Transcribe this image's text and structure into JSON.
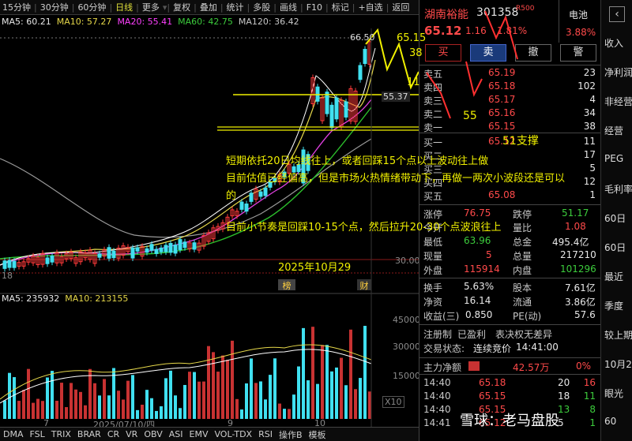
{
  "toolbar": {
    "items": [
      "15分钟",
      "30分钟",
      "60分钟",
      "日线",
      "更多",
      "复权",
      "叠加",
      "统计",
      "多股",
      "画线",
      "F10",
      "标记",
      "+自选",
      "返回"
    ],
    "selected": "日线"
  },
  "ma_legend": {
    "ma5": "MA5: 60.21",
    "ma10": "MA10: 57.27",
    "ma20": "MA20: 55.41",
    "ma60": "MA60: 42.75",
    "ma120": "MA120: 36.42"
  },
  "price_labels": {
    "high": "66.50",
    "y30": "30.00",
    "line": "55.37"
  },
  "vol_legend": {
    "ma5": "MA5: 235932",
    "ma10": "MA10: 213155"
  },
  "vol_axis": [
    "45000",
    "30000",
    "15000",
    "X10"
  ],
  "date_axis": {
    "left": "7",
    "mid": "2025/07/10/四",
    "b": "9",
    "c": "10"
  },
  "markers": {
    "bang": "榜",
    "cai": "财"
  },
  "bottom_tabs": [
    "DMA",
    "FSL",
    "TRIX",
    "BRAR",
    "CR",
    "VR",
    "OBV",
    "ASI",
    "EMV",
    "VOL-TDX",
    "RSI",
    "操作B",
    "模板"
  ],
  "annotations": {
    "a1": "短期依托20日均线往上，或者回踩15个点以上波动往上做",
    "a2": "目前估值已经偏高，但是市场火热情绪带动下，再做一两次小波段还是可以",
    "a3": "的",
    "a4": "目前小节奏是回踩10-15个点，然后拉升20-30个点波浪往上",
    "date": "2025年10月29",
    "n55": "55",
    "n51": "51支撑",
    "l38": "38",
    "l11": "11",
    "l6515": "65.15"
  },
  "stock": {
    "name": "湖南裕能",
    "code": "301358",
    "tag": "R500",
    "price": "65.12",
    "change": "1.16",
    "pct": "1.81%",
    "category": "电池",
    "cat_pct": "3.88%"
  },
  "buttons": {
    "buy": "买",
    "sell": "卖",
    "cancel": "撤",
    "alert": "警"
  },
  "sell_orders": [
    {
      "l": "卖五",
      "p": "65.19",
      "v": "23"
    },
    {
      "l": "卖四",
      "p": "65.18",
      "v": "102"
    },
    {
      "l": "卖三",
      "p": "65.17",
      "v": "4"
    },
    {
      "l": "卖二",
      "p": "65.16",
      "v": "34"
    },
    {
      "l": "卖一",
      "p": "65.15",
      "v": "38"
    }
  ],
  "buy_orders": [
    {
      "l": "买一",
      "p": "65.12",
      "v": "11"
    },
    {
      "l": "买二",
      "p": "",
      "v": "17"
    },
    {
      "l": "买三",
      "p": "",
      "v": "5"
    },
    {
      "l": "买四",
      "p": "",
      "v": "12"
    },
    {
      "l": "买五",
      "p": "65.08",
      "v": "1"
    }
  ],
  "quote": {
    "zt_l": "涨停",
    "zt": "76.75",
    "dt_l": "跌停",
    "dt": "51.17",
    "jk_l": "今开",
    "jk": "",
    "lb_l": "量比",
    "lb": "1.08",
    "zd_l": "最低",
    "zd": "63.96",
    "zj_l": "总金",
    "zj": "495.4亿",
    "xl_l": "现量",
    "xl": "5",
    "zl_l": "总量",
    "zl": "217210",
    "wp_l": "外盘",
    "wp": "115914",
    "np_l": "内盘",
    "np": "101296",
    "hs_l": "换手",
    "hs": "5.63%",
    "gb_l": "股本",
    "gb": "7.61亿",
    "jz_l": "净资",
    "jz": "16.14",
    "lt_l": "流通",
    "lt": "3.86亿",
    "sy_l": "收益(三)",
    "sy": "0.850",
    "pe_l": "PE(动)",
    "pe": "57.6",
    "reg": "注册制",
    "prof": "已盈利",
    "vote": "表决权无差异",
    "st_l": "交易状态:",
    "st": "连续竞价",
    "st_t": "14:41:00",
    "net_l": "主力净额",
    "net": "42.57万",
    "net_pct": "0%"
  },
  "ticks": [
    {
      "t": "14:40",
      "p": "65.18",
      "v": "20",
      "d": "16"
    },
    {
      "t": "14:40",
      "p": "65.15",
      "v": "18",
      "d": "11"
    },
    {
      "t": "14:40",
      "p": "65.15",
      "v": "13",
      "d": "8"
    },
    {
      "t": "14:41",
      "p": "65.12",
      "v": "5",
      "d": "1"
    }
  ],
  "far": [
    "收入",
    "净利润",
    "非经营",
    "经营",
    "PEG",
    "毛利率",
    "60日",
    "60日",
    "最近",
    "季度",
    "较上期",
    "10月2",
    "眼光",
    "60"
  ],
  "watermark": "雪球：老马盘股"
}
